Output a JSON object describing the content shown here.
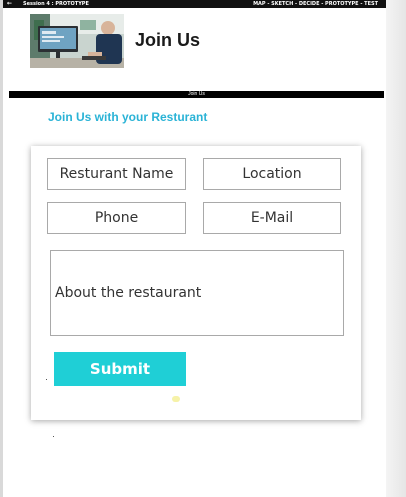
{
  "topbar": {
    "back_icon": "back-arrow-icon",
    "left_label": "Session 4 : PROTOTYPE",
    "right_label": "MAP - SKETCH - DECIDE - PROTOTYPE - TEST"
  },
  "header": {
    "title": "Join Us",
    "hero_image": "office-desk-computer-photo"
  },
  "section_bar": {
    "label": "Join Us"
  },
  "form": {
    "heading": "Join Us with your Resturant",
    "fields": {
      "name_placeholder": "Resturant Name",
      "location_placeholder": "Location",
      "phone_placeholder": "Phone",
      "email_placeholder": "E-Mail",
      "about_placeholder": "About the restaurant"
    },
    "submit_label": "Submit"
  },
  "colors": {
    "accent": "#2ab3d6",
    "submit_bg": "#1fcfd6",
    "bar_bg": "#000000"
  }
}
